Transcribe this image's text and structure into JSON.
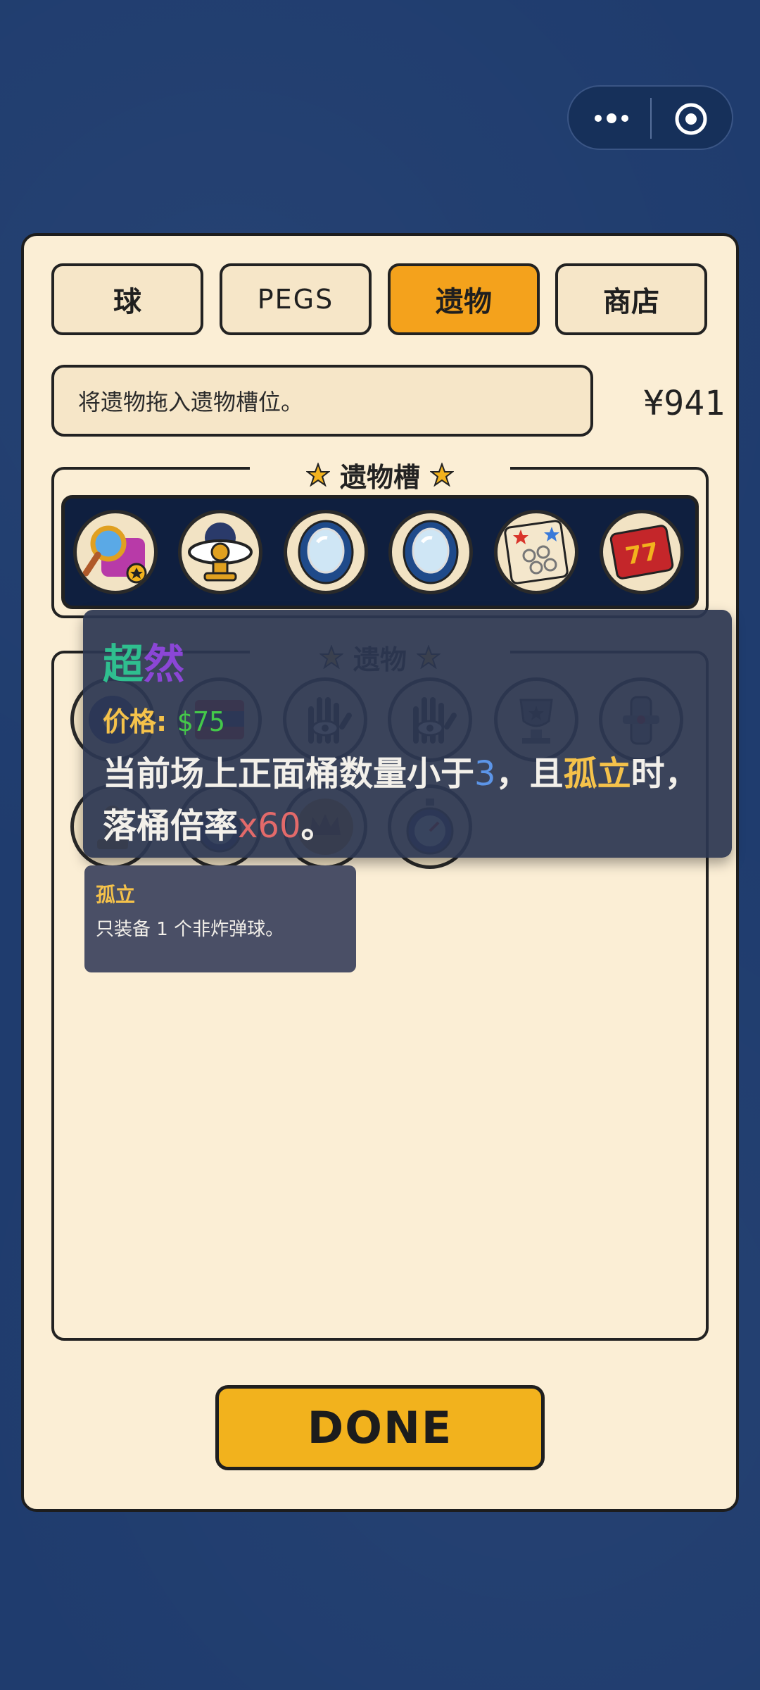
{
  "tabs": [
    {
      "label": "球",
      "active": false
    },
    {
      "label": "PEGS",
      "active": false
    },
    {
      "label": "遗物",
      "active": true
    },
    {
      "label": "商店",
      "active": false
    }
  ],
  "hint": "将遗物拖入遗物槽位。",
  "money": "¥941",
  "relic_slots": {
    "title": "遗物槽",
    "items": [
      {
        "icon": "magnifier-star-relic-icon"
      },
      {
        "icon": "eye-pedestal-relic-icon"
      },
      {
        "icon": "mirror-relic-icon"
      },
      {
        "icon": "mirror-relic-icon"
      },
      {
        "icon": "star-card-relic-icon"
      },
      {
        "icon": "slot-77-ticket-relic-icon"
      }
    ]
  },
  "inventory": {
    "title": "遗物"
  },
  "tooltip": {
    "name_part1": "超",
    "name_part2": "然",
    "price_label": "价格",
    "price_colon": ":",
    "price_value": "$75",
    "desc_line1_a": "当前场上正面桶数量小于",
    "desc_line1_num": "3",
    "desc_line1_b": "，且",
    "desc_line1_kw": "孤立",
    "desc_line1_c": "时，",
    "desc_line2_a": "落桶倍率",
    "desc_line2_mult": "x60",
    "desc_line2_b": "。",
    "colors": {
      "name1": "#2fbf8f",
      "name2": "#8b46d6",
      "number": "#5c95e8",
      "keyword": "#f5c24a",
      "multiplier": "#e36a6a"
    }
  },
  "subtooltip": {
    "title": "孤立",
    "desc": "只装备 1 个非炸弹球。"
  },
  "done_label": "DONE",
  "colors": {
    "background": "#1f3c6e",
    "panel": "#fbeed5",
    "active_tab": "#f4a21c",
    "done": "#f2b21d"
  }
}
